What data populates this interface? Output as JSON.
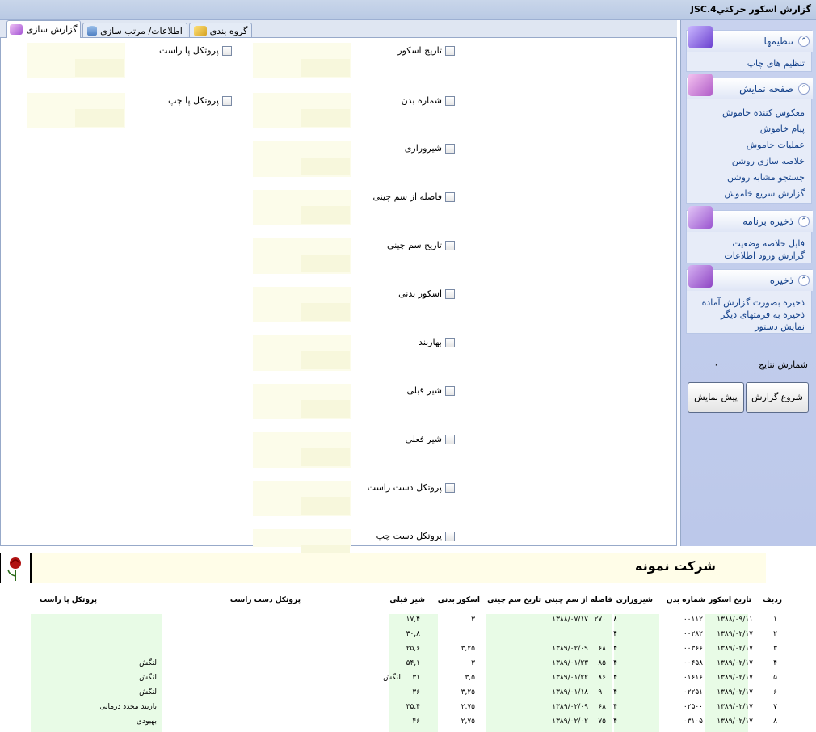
{
  "window": {
    "title": "گزارش اسکور حرکتيJSC.4"
  },
  "tabs": [
    {
      "label": "گزارش سازی",
      "active": true
    },
    {
      "label": "اطلاعات/ مرتب سازی",
      "active": false
    },
    {
      "label": "گروه بندی",
      "active": false
    }
  ],
  "left_checks": [
    "پروتکل پا راست",
    "پروتکل پا چپ"
  ],
  "main_checks": [
    "تاریخ اسکور",
    "شماره بدن",
    "شیروراری",
    "فاصله از سم چینی",
    "تاریخ سم چینی",
    "اسکور بدنی",
    "بهاربند",
    "شیر قبلی",
    "شیر فعلی",
    "پروتکل دست راست",
    "پروتکل دست چپ"
  ],
  "sidebar": {
    "groups": [
      {
        "title": "تنظیمها",
        "icon_color": "#7b5bd6",
        "items": [
          "تنظیم های چاپ"
        ]
      },
      {
        "title": "صفحه نمایش",
        "icon_color": "#c77bd4",
        "items": [
          "معکوس کننده خاموش",
          "پیام خاموش",
          "عملیات خاموش",
          "خلاصه سازی روشن",
          "جستجو مشابه روشن",
          "گزارش سریع خاموش"
        ]
      },
      {
        "title": "ذخیره برنامه",
        "icon_color": "#a05ad0",
        "items": [
          "فایل خلاصه وضعیت",
          "گزارش ورود اطلاعات"
        ]
      },
      {
        "title": "ذخیره",
        "icon_color": "#9a4fc8",
        "items": [
          "ذخیره بصورت گزارش آماده",
          "ذخیره به فرمتهای دیگر",
          "نمایش دستور"
        ]
      }
    ],
    "results_label": "شمارش نتایج",
    "results_count": "۰",
    "start_button": "شروع گزارش",
    "preview_button": "پیش نمایش"
  },
  "report": {
    "company": "شرکت نمونه",
    "columns": [
      "ردیف",
      "تاریخ اسکور",
      "شماره بدن",
      "شیروراری",
      "فاصله از سم چینی",
      "تاریخ سم چینی",
      "اسکور بدنی",
      "شیر قبلی",
      "پروتکل دست راست",
      "پروتکل پا راست"
    ],
    "rows": [
      {
        "n": "۱",
        "date": "۱۳۸۸/۰۹/۱۱",
        "body": "۰۰۱۱۲",
        "milk": "۸",
        "dist": "۲۷۰",
        "trim": "۱۳۸۸/۰۷/۱۷",
        "score": "۳",
        "prev": "۱۷,۴",
        "hand": "",
        "foot": ""
      },
      {
        "n": "۲",
        "date": "۱۳۸۹/۰۲/۱۷",
        "body": "۰۰۲۸۲",
        "milk": "۴",
        "dist": "",
        "trim": "",
        "score": "",
        "prev": "۳۰,۸",
        "hand": "",
        "foot": ""
      },
      {
        "n": "۳",
        "date": "۱۳۸۹/۰۲/۱۷",
        "body": "۰۰۳۶۶",
        "milk": "۴",
        "dist": "۶۸",
        "trim": "۱۳۸۹/۰۲/۰۹",
        "score": "۳,۲۵",
        "prev": "۲۵,۶",
        "hand": "",
        "foot": ""
      },
      {
        "n": "۴",
        "date": "۱۳۸۹/۰۲/۱۷",
        "body": "۰۰۴۵۸",
        "milk": "۴",
        "dist": "۸۵",
        "trim": "۱۳۸۹/۰۱/۲۳",
        "score": "۳",
        "prev": "۵۴,۱",
        "hand": "",
        "foot": "لنگش"
      },
      {
        "n": "۵",
        "date": "۱۳۸۹/۰۲/۱۷",
        "body": "۰۱۶۱۶",
        "milk": "۴",
        "dist": "۸۶",
        "trim": "۱۳۸۹/۰۱/۲۲",
        "score": "۳,۵",
        "prev": "۳۱",
        "hand": "لنگش",
        "foot": "لنگش"
      },
      {
        "n": "۶",
        "date": "۱۳۸۹/۰۲/۱۷",
        "body": "۰۲۲۵۱",
        "milk": "۴",
        "dist": "۹۰",
        "trim": "۱۳۸۹/۰۱/۱۸",
        "score": "۳,۲۵",
        "prev": "۳۶",
        "hand": "",
        "foot": "لنگش"
      },
      {
        "n": "۷",
        "date": "۱۳۸۹/۰۲/۱۷",
        "body": "۰۲۵۰۰",
        "milk": "۴",
        "dist": "۶۸",
        "trim": "۱۳۸۹/۰۲/۰۹",
        "score": "۲,۷۵",
        "prev": "۳۵,۴",
        "hand": "",
        "foot": "بازبند مجدد درمانی"
      },
      {
        "n": "۸",
        "date": "۱۳۸۹/۰۲/۱۷",
        "body": "۰۳۱۰۵",
        "milk": "۴",
        "dist": "۷۵",
        "trim": "۱۳۸۹/۰۲/۰۲",
        "score": "۲,۷۵",
        "prev": "۴۶",
        "hand": "",
        "foot": "بهبودی"
      }
    ]
  }
}
